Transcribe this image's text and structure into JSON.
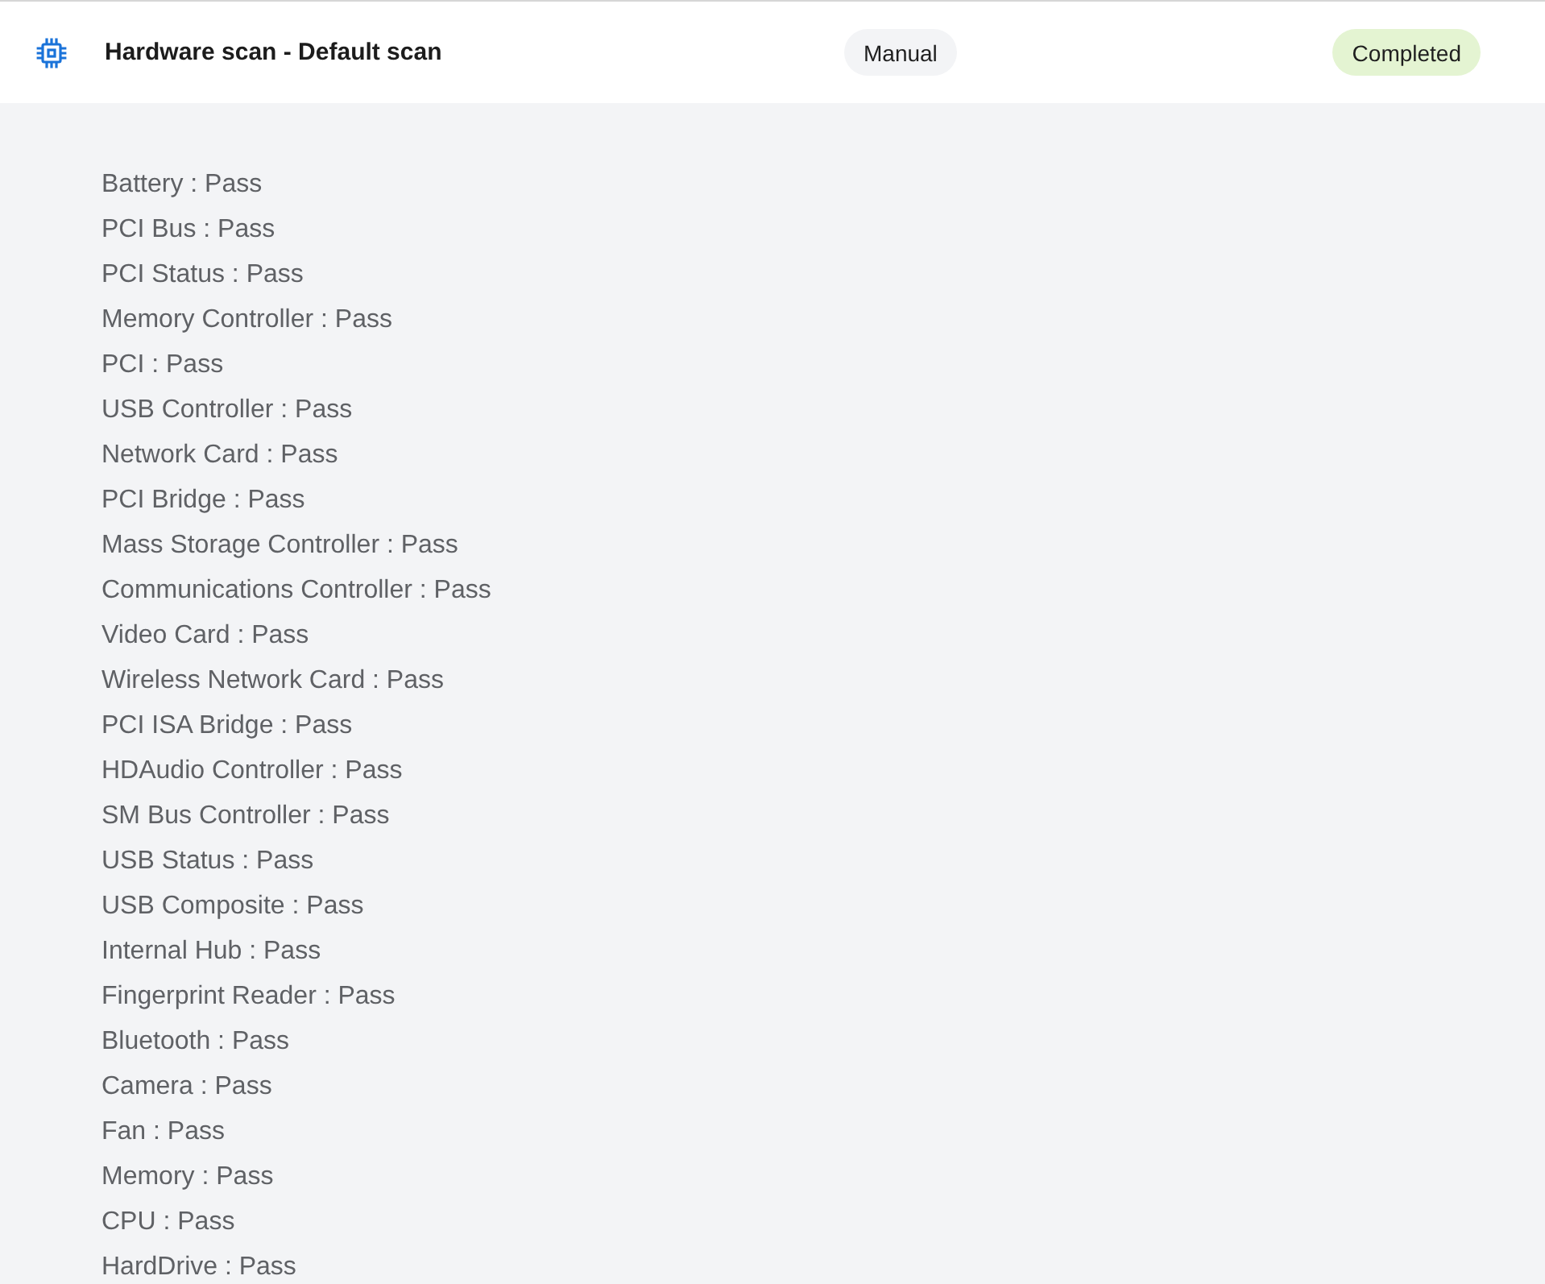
{
  "header": {
    "title": "Hardware scan - Default scan",
    "mode": "Manual",
    "status": "Completed"
  },
  "results": [
    "Battery : Pass",
    "PCI Bus : Pass",
    "PCI Status : Pass",
    "Memory Controller : Pass",
    "PCI : Pass",
    "USB Controller : Pass",
    "Network Card : Pass",
    "PCI Bridge : Pass",
    "Mass Storage Controller : Pass",
    "Communications Controller : Pass",
    "Video Card : Pass",
    "Wireless Network Card : Pass",
    "PCI ISA Bridge : Pass",
    "HDAudio Controller : Pass",
    "SM Bus Controller : Pass",
    "USB Status : Pass",
    "USB Composite : Pass",
    "Internal Hub : Pass",
    "Fingerprint Reader : Pass",
    "Bluetooth : Pass",
    "Camera : Pass",
    "Fan : Pass",
    "Memory : Pass",
    "CPU : Pass",
    "HardDrive : Pass"
  ]
}
